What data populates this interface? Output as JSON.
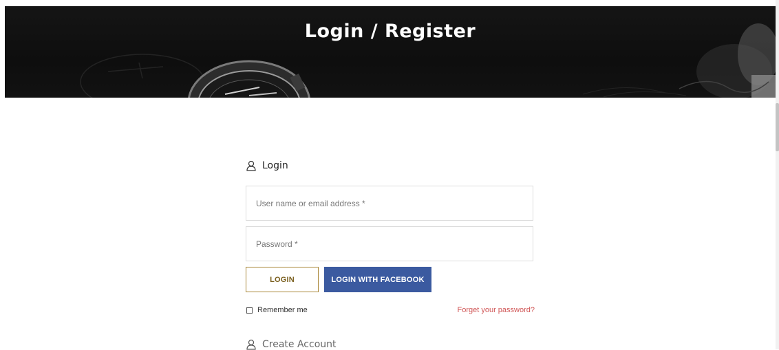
{
  "banner": {
    "title": "Login / Register"
  },
  "login_section": {
    "heading": "Login",
    "icon": "user-icon"
  },
  "form": {
    "username_placeholder": "User name or email address *",
    "password_placeholder": "Password *",
    "login_button": "LOGIN",
    "facebook_button": "LOGIN WITH FACEBOOK",
    "remember_label": "Remember me",
    "forgot_link": "Forget your password?"
  },
  "create_section": {
    "heading": "Create Account",
    "icon": "user-icon"
  },
  "colors": {
    "banner_bg": "#111111",
    "login_border": "#a78433",
    "facebook_blue": "#3b5aa0",
    "forgot_link": "#d05656"
  }
}
